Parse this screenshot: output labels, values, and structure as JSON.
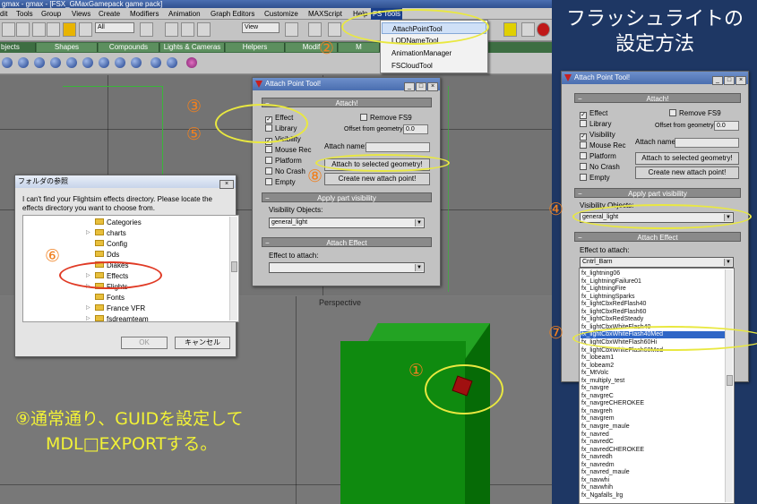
{
  "window": {
    "title": "gmax - gmax - [FSX_GMaxGamepack game pack]"
  },
  "menubar": {
    "items": [
      "dit",
      "Tools",
      "Group",
      "Views",
      "Create",
      "Modifiers",
      "Animation",
      "Graph Editors",
      "Customize",
      "MAXScript",
      "Help",
      "FS Tools"
    ],
    "active": "FS Tools"
  },
  "toolbar": {
    "selection_filter": "All",
    "coord_system": "View"
  },
  "command_tabs": [
    "bjects",
    "Shapes",
    "Compounds",
    "Lights & Cameras",
    "Helpers",
    "Modif",
    "M"
  ],
  "fs_tools_menu": [
    "AttachPointTool",
    "LODNameTool",
    "AnimationManager",
    "FSCloudTool"
  ],
  "viewports": {
    "perspective_label": "Perspective"
  },
  "attach_tool": {
    "title": "Attach Point Tool!",
    "rollout_attach": "Attach!",
    "checkboxes": [
      {
        "label": "Effect",
        "checked": true
      },
      {
        "label": "Library",
        "checked": false
      },
      {
        "label": "Visibility",
        "checked": true
      },
      {
        "label": "Mouse Rec",
        "checked": false
      },
      {
        "label": "Platform",
        "checked": false
      },
      {
        "label": "No Crash",
        "checked": false
      },
      {
        "label": "Empty",
        "checked": false
      }
    ],
    "remove_fs9": "Remove FS9",
    "offset_label": "Offset from geometry:",
    "offset_value": "0.0",
    "attach_name_label": "Attach name:",
    "attach_selected_btn": "Attach to selected geometry!",
    "create_new_btn": "Create new attach point!",
    "rollout_visibility": "Apply part visibility",
    "visibility_label": "Visibility Objects:",
    "visibility_value": "general_light",
    "rollout_effect": "Attach Effect",
    "effect_label": "Effect to attach:",
    "effect_value": "Cntrl_Barn"
  },
  "folder_dialog": {
    "title": "フォルダの参照",
    "message": "I can't find your Flightsim effects directory. Please locate the effects directory you want to choose from.",
    "folders": [
      "Categories",
      "charts",
      "Config",
      "Dds",
      "Diakes",
      "Effects",
      "Flights",
      "Fonts",
      "France VFR",
      "fsdreamteam"
    ],
    "ok_label": "OK",
    "cancel_label": "キャンセル"
  },
  "effects_list": [
    "fx_lightning06",
    "fx_LightningFailure01",
    "fx_LightningFire",
    "fx_LightningSparks",
    "fx_lightCbxRedFlash40",
    "fx_lightCbxRedFlash60",
    "fx_lightCbxRedSteady",
    "fx_lightCbxWhiteFlash40",
    "fx_lightCbxWhiteFlash40Med",
    "fx_lightCbxWhiteFlash60Hi",
    "fx_lightCbxWhiteFlash60Med",
    "fx_lobeam1",
    "fx_lobeam2",
    "fx_MtVolc",
    "fx_multiply_test",
    "fx_navgre",
    "fx_navgreC",
    "fx_navgreCHEROKEE",
    "fx_navgreh",
    "fx_navgrem",
    "fx_navgre_maule",
    "fx_navred",
    "fx_navredC",
    "fx_navredCHEROKEE",
    "fx_navredh",
    "fx_navredm",
    "fx_navred_maule",
    "fx_navwhi",
    "fx_navwhih",
    "fx_Ngafalls_lrg"
  ],
  "effects_selected": "fx_lightCbxWhiteFlash40Med",
  "annotations": {
    "panel_title_line1": "フラッシュライトの",
    "panel_title_line2": "設定方法",
    "n1": "①",
    "n2": "②",
    "n3": "③",
    "n4": "④",
    "n5": "⑤",
    "n6": "⑥",
    "n7": "⑦",
    "n8": "⑧",
    "bottom_line1": "⑨通常通り、GUIDを設定して",
    "bottom_line2": "MDL□EXPORTする。"
  },
  "colors": {
    "annotation_yellow": "#f2f236",
    "annotation_orange": "#f08020",
    "panel_bg": "#1e3764",
    "box_green": "#0f8a0f"
  }
}
